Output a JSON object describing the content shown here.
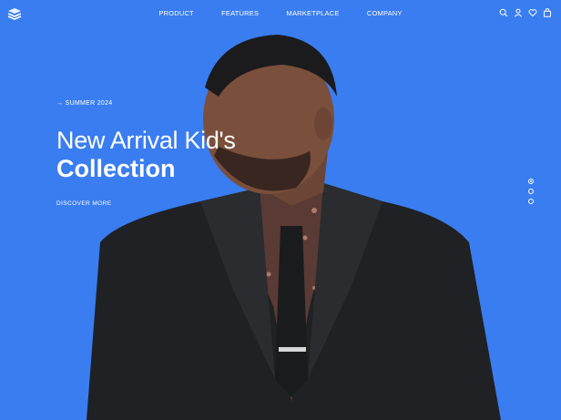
{
  "brand": {
    "logo_icon": "stacked-wave-logo"
  },
  "nav": {
    "items": [
      {
        "label": "PRODUCT"
      },
      {
        "label": "FEATURES"
      },
      {
        "label": "MARKETPLACE"
      },
      {
        "label": "COMPANY"
      }
    ]
  },
  "header_icons": [
    "search-icon",
    "user-icon",
    "heart-icon",
    "bag-icon"
  ],
  "hero": {
    "eyebrow": "→ SUMMER 2024",
    "title_line1": "New Arrival Kid's",
    "title_line2": "Collection",
    "cta": "DISCOVER MORE",
    "image": "man-in-black-suit"
  },
  "slider": {
    "count": 3,
    "active_index": 0
  },
  "colors": {
    "background": "#3A7DF0",
    "text": "#FFFFFF"
  }
}
